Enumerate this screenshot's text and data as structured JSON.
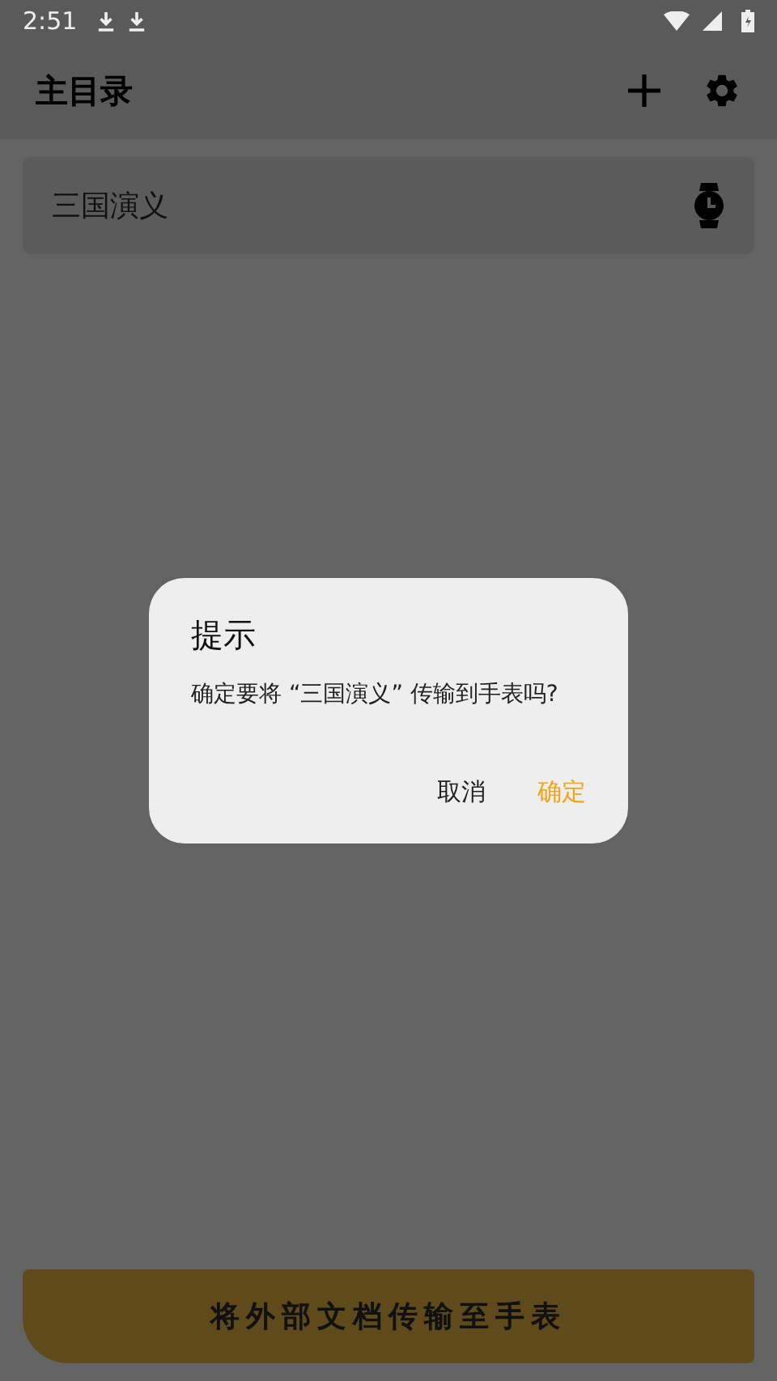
{
  "status_bar": {
    "time": "2:51"
  },
  "app_bar": {
    "title": "主目录"
  },
  "books": [
    {
      "title": "三国演义"
    }
  ],
  "dialog": {
    "title": "提示",
    "message": "确定要将 “三国演义” 传输到手表吗?",
    "buttons": [
      {
        "label": "取消",
        "kind": "cancel"
      },
      {
        "label": "确定",
        "kind": "confirm"
      }
    ]
  },
  "bottom_button": {
    "label": "将外部文档传输至手表"
  }
}
